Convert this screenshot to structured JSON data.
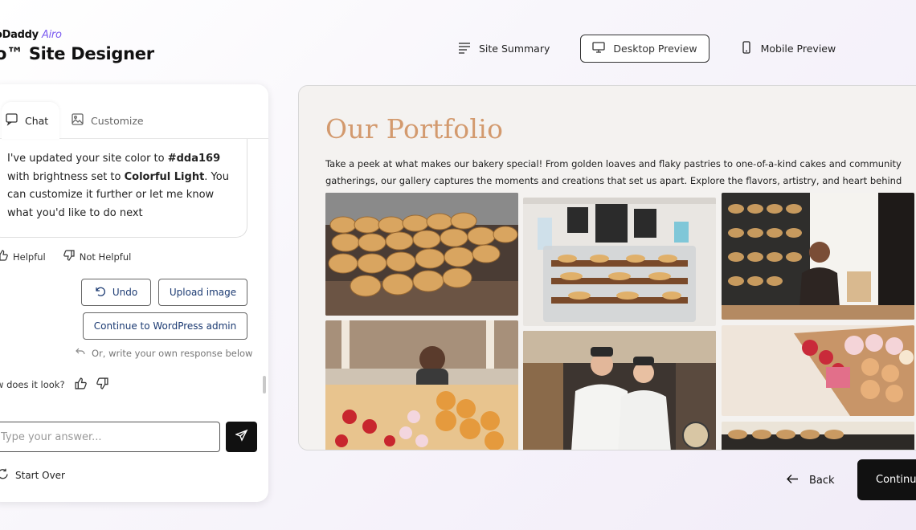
{
  "brand": {
    "name_prefix": "oDaddy",
    "name_accent": "Airo",
    "title": "o™ Site Designer"
  },
  "topnav": [
    {
      "label": "Site Summary",
      "icon": "list-lines-icon"
    },
    {
      "label": "Desktop Preview",
      "icon": "monitor-icon",
      "active": true
    },
    {
      "label": "Mobile Preview",
      "icon": "phone-icon"
    }
  ],
  "tabs": {
    "chat": "Chat",
    "customize": "Customize"
  },
  "message": {
    "part1": "I've updated your site color to ",
    "color": "#dda169",
    "part2": " with brightness set to ",
    "brightness": "Colorful Light",
    "part3": ". You can customize it further or let me know what you'd like to do next"
  },
  "feedback": {
    "helpful": "Helpful",
    "not_helpful": "Not Helpful"
  },
  "actions": {
    "undo": "Undo",
    "upload": "Upload image",
    "wordpress": "Continue to WordPress admin"
  },
  "hint": "Or, write your own response below",
  "rate_prompt": "ow does it look?",
  "input": {
    "placeholder": "Type your answer..."
  },
  "start_over": "Start Over",
  "preview": {
    "title": "Our Portfolio",
    "description": "Take a peek at what makes our bakery special! From golden loaves and flaky pastries to one-of-a-kind cakes and community gatherings, our gallery captures the moments and creations that set us apart. Explore the flavors, artistry, and heart behind every bake."
  },
  "footer": {
    "back": "Back",
    "continue": "Continu"
  },
  "colors": {
    "accent": "#dda169",
    "title_color": "#d39a6e",
    "brand_purple": "#7c5cf0"
  }
}
